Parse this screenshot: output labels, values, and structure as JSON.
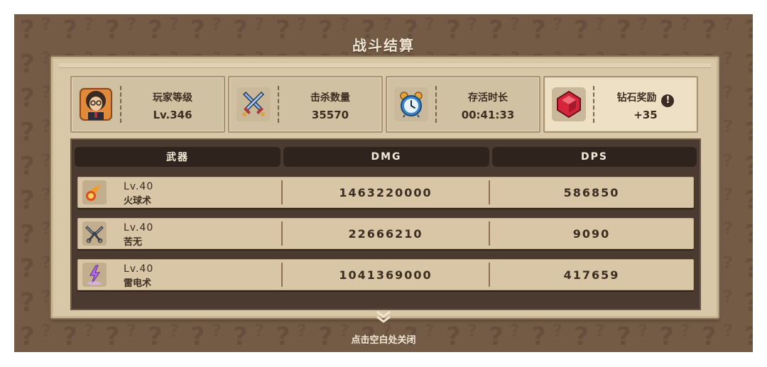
{
  "window": {
    "title": "战斗结算"
  },
  "stats": [
    {
      "label": "玩家等级",
      "value": "Lv.346",
      "icon": "avatar-icon"
    },
    {
      "label": "击杀数量",
      "value": "35570",
      "icon": "crossed-swords-icon"
    },
    {
      "label": "存活时长",
      "value": "00:41:33",
      "icon": "alarm-clock-icon"
    },
    {
      "label": "钻石奖励",
      "value": "+35",
      "icon": "red-gem-icon",
      "info_icon": "exclamation-icon"
    }
  ],
  "table": {
    "headers": [
      "武器",
      "DMG",
      "DPS"
    ],
    "rows": [
      {
        "level": "Lv.40",
        "name": "火球术",
        "dmg": "1463220000",
        "dps": "586850",
        "icon": "fireball-icon"
      },
      {
        "level": "Lv.40",
        "name": "苦无",
        "dmg": "22666210",
        "dps": "9090",
        "icon": "kunai-icon"
      },
      {
        "level": "Lv.40",
        "name": "雷电术",
        "dmg": "1041369000",
        "dps": "417659",
        "icon": "lightning-icon"
      }
    ]
  },
  "footer": {
    "close_hint": "点击空白处关闭",
    "chevron_icon": "double-chevron-down-icon"
  },
  "colors": {
    "background": "#745b46",
    "panel": "#d9c8a8",
    "table_bg": "#4a3a2f",
    "header_bg": "#2f241d",
    "text": "#3d2e22"
  }
}
